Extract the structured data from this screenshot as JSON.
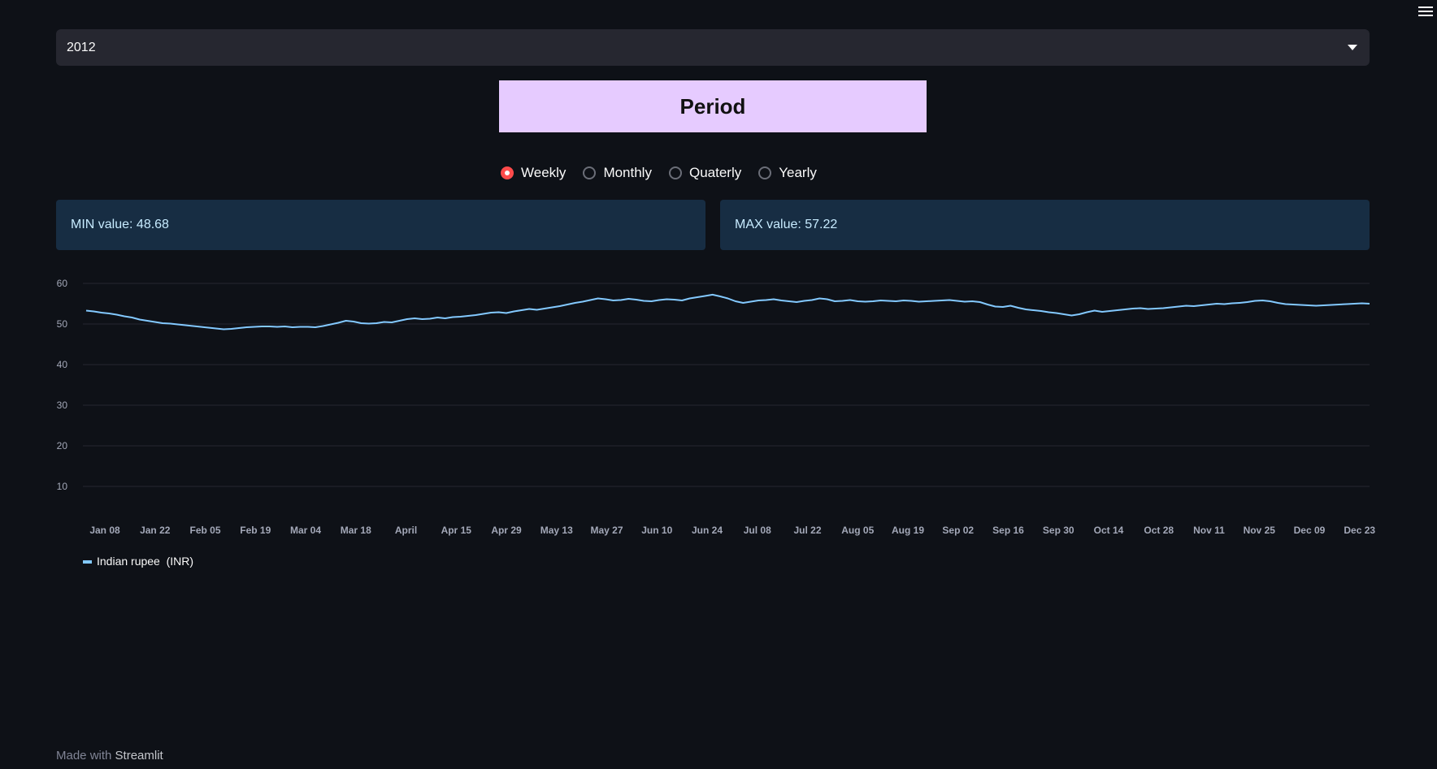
{
  "menu": {
    "icon": "hamburger-menu-icon"
  },
  "year_select": {
    "value": "2012",
    "icon": "chevron-down-icon"
  },
  "period_header": "Period",
  "period_options": [
    {
      "label": "Weekly",
      "checked": true
    },
    {
      "label": "Monthly",
      "checked": false
    },
    {
      "label": "Quaterly",
      "checked": false
    },
    {
      "label": "Yearly",
      "checked": false
    }
  ],
  "min_box": "MIN value: 48.68",
  "max_box": "MAX value: 57.22",
  "footer": {
    "prefix": "Made with",
    "brand": "Streamlit"
  },
  "colors": {
    "background": "#0e1117",
    "line": "#83c9ff",
    "accent": "#ff4b4b",
    "period_bg": "#e6cbff",
    "info_bg": "#172d43"
  },
  "chart_data": {
    "type": "line",
    "title": "",
    "xlabel": "",
    "ylabel": "",
    "ylim": [
      0,
      60
    ],
    "yticks": [
      10,
      20,
      30,
      40,
      50,
      60
    ],
    "grid": true,
    "legend_position": "bottom-left",
    "x_tick_labels": [
      "Jan 08",
      "Jan 22",
      "Feb 05",
      "Feb 19",
      "Mar 04",
      "Mar 18",
      "April",
      "Apr 15",
      "Apr 29",
      "May 13",
      "May 27",
      "Jun 10",
      "Jun 24",
      "Jul 08",
      "Jul 22",
      "Aug 05",
      "Aug 19",
      "Sep 02",
      "Sep 16",
      "Sep 30",
      "Oct 14",
      "Oct 28",
      "Nov 11",
      "Nov 25",
      "Dec 09",
      "Dec 23"
    ],
    "series": [
      {
        "name": "Indian rupee  (INR)",
        "color": "#83c9ff",
        "values": [
          53.3,
          53.1,
          52.8,
          52.6,
          52.3,
          51.9,
          51.6,
          51.1,
          50.8,
          50.5,
          50.2,
          50.1,
          49.9,
          49.7,
          49.5,
          49.3,
          49.1,
          48.9,
          48.7,
          48.8,
          49.0,
          49.2,
          49.3,
          49.4,
          49.4,
          49.3,
          49.4,
          49.2,
          49.3,
          49.3,
          49.2,
          49.5,
          49.9,
          50.3,
          50.8,
          50.6,
          50.2,
          50.1,
          50.2,
          50.5,
          50.4,
          50.8,
          51.2,
          51.4,
          51.2,
          51.3,
          51.6,
          51.4,
          51.7,
          51.8,
          52.0,
          52.2,
          52.5,
          52.8,
          52.9,
          52.7,
          53.1,
          53.4,
          53.7,
          53.5,
          53.8,
          54.1,
          54.4,
          54.8,
          55.2,
          55.5,
          55.9,
          56.3,
          56.1,
          55.8,
          55.9,
          56.2,
          56.0,
          55.7,
          55.6,
          55.9,
          56.1,
          56.0,
          55.8,
          56.3,
          56.6,
          56.9,
          57.22,
          56.8,
          56.3,
          55.6,
          55.2,
          55.5,
          55.8,
          55.9,
          56.1,
          55.8,
          55.6,
          55.4,
          55.7,
          55.9,
          56.3,
          56.1,
          55.6,
          55.7,
          55.9,
          55.6,
          55.5,
          55.6,
          55.8,
          55.7,
          55.6,
          55.8,
          55.7,
          55.5,
          55.6,
          55.7,
          55.8,
          55.9,
          55.7,
          55.5,
          55.6,
          55.4,
          54.8,
          54.3,
          54.2,
          54.5,
          54.0,
          53.6,
          53.4,
          53.2,
          52.9,
          52.7,
          52.4,
          52.1,
          52.4,
          52.9,
          53.3,
          53.0,
          53.2,
          53.4,
          53.6,
          53.8,
          53.9,
          53.7,
          53.8,
          53.9,
          54.1,
          54.3,
          54.5,
          54.4,
          54.6,
          54.8,
          55.0,
          54.9,
          55.1,
          55.2,
          55.4,
          55.7,
          55.8,
          55.6,
          55.2,
          54.9,
          54.8,
          54.7,
          54.6,
          54.5,
          54.6,
          54.7,
          54.8,
          54.9,
          55.0,
          55.1,
          55.0
        ]
      }
    ]
  }
}
